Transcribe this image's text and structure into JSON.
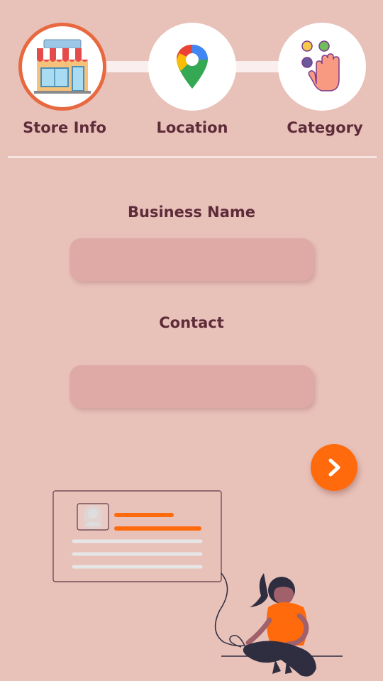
{
  "steps": [
    {
      "label": "Store Info",
      "icon": "store-icon",
      "active": true
    },
    {
      "label": "Location",
      "icon": "map-pin-icon",
      "active": false
    },
    {
      "label": "Category",
      "icon": "hand-select-icon",
      "active": false
    }
  ],
  "form": {
    "business_name_label": "Business Name",
    "business_name_value": "",
    "contact_label": "Contact",
    "contact_value": ""
  },
  "next_button": {
    "icon": "chevron-right-icon"
  },
  "colors": {
    "background": "#e8c1b9",
    "accent": "#ff6a0d",
    "active_ring": "#e8683f",
    "label_text": "#5e2b39",
    "input_fill": "#dfa9a5"
  }
}
